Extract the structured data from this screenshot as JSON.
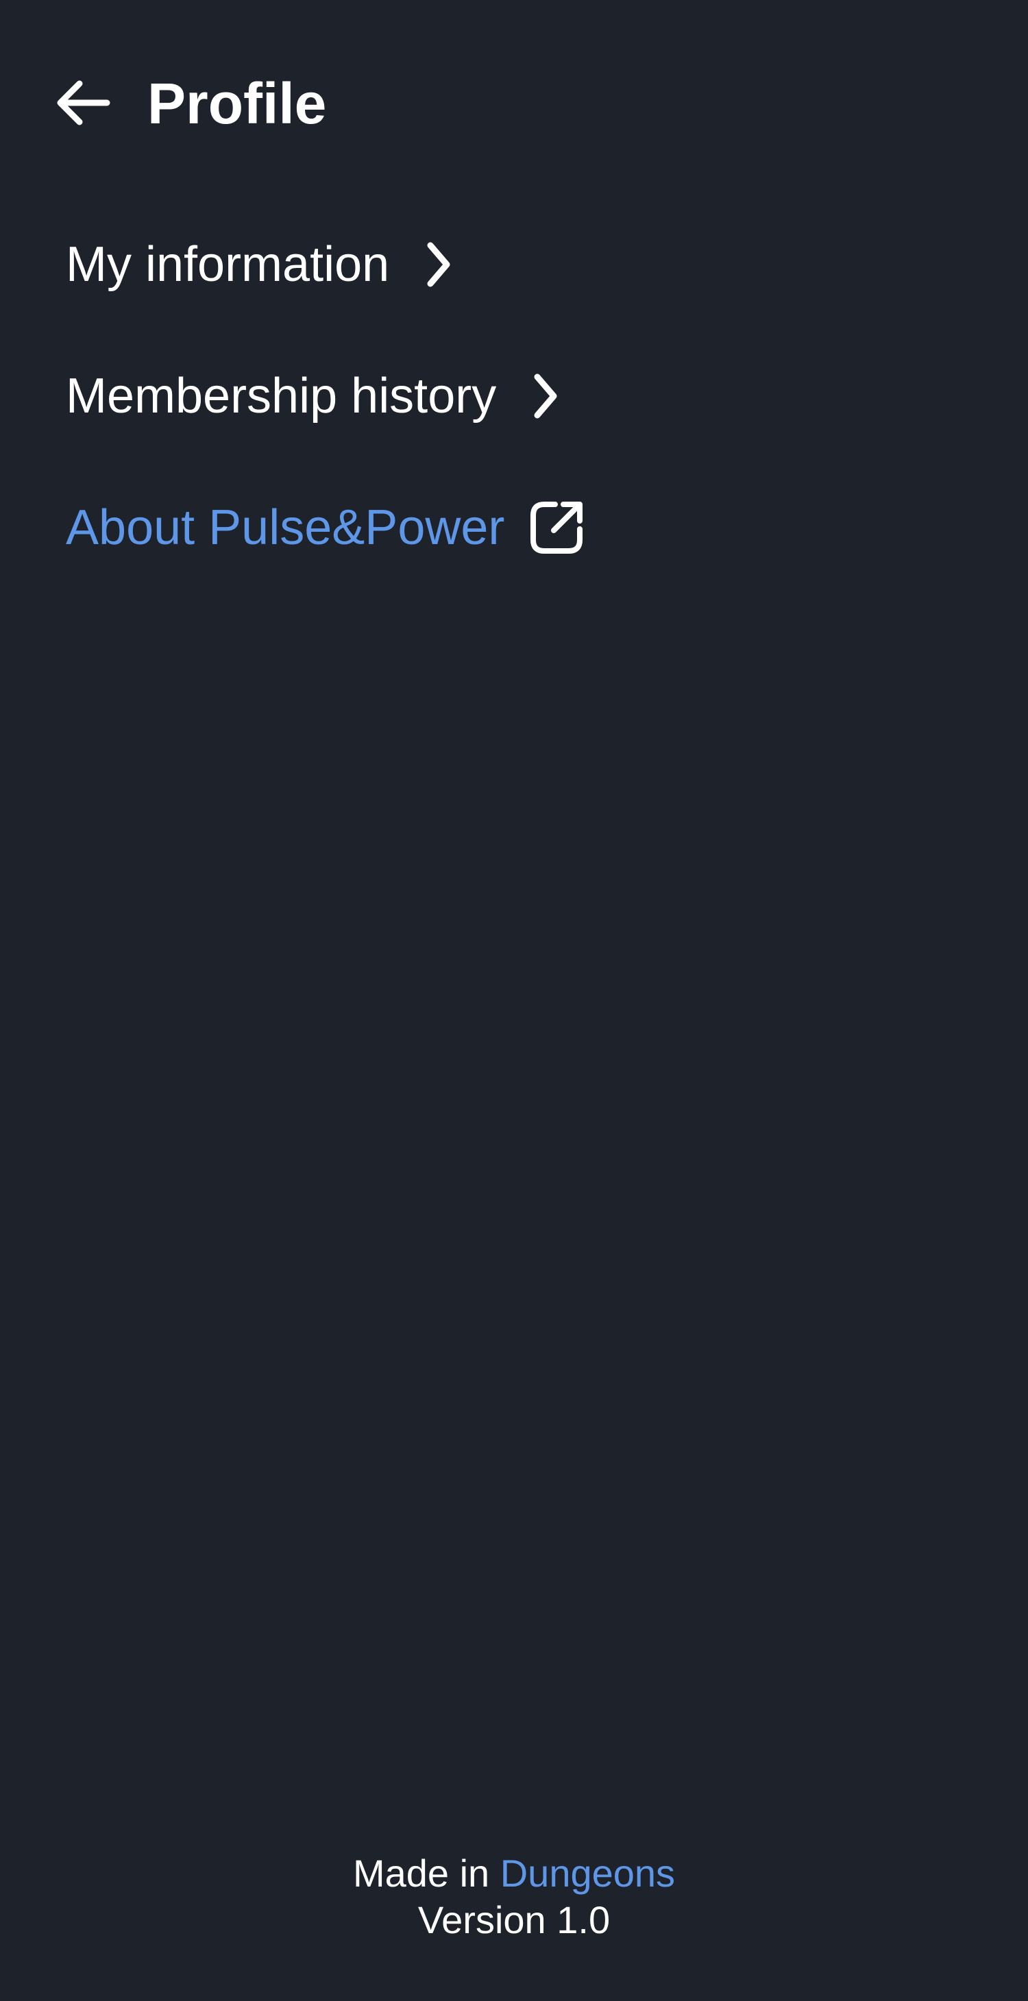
{
  "header": {
    "title": "Profile",
    "back_icon": "arrow-left-icon"
  },
  "menu": {
    "items": [
      {
        "label": "My information",
        "icon": "chevron-right-icon"
      },
      {
        "label": "Membership history",
        "icon": "chevron-right-icon"
      },
      {
        "label": "About Pulse&Power",
        "icon": "external-link-icon"
      }
    ]
  },
  "footer": {
    "made_in_prefix": "Made in ",
    "made_in_link": "Dungeons",
    "version": "Version 1.0"
  },
  "colors": {
    "background": "#1e222b",
    "text": "#ffffff",
    "accent": "#5f97e8"
  }
}
